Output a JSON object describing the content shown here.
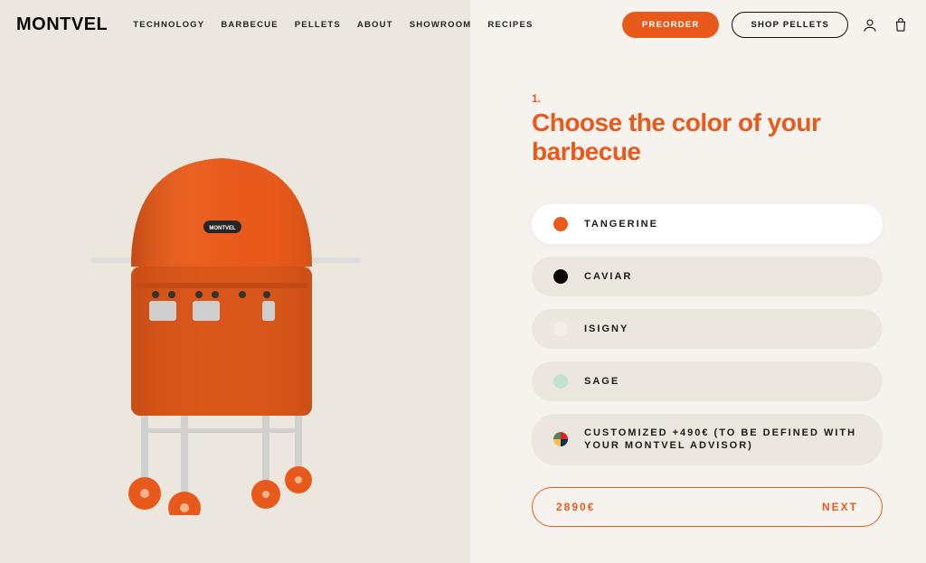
{
  "brand": "MONTVEL",
  "nav": {
    "items": [
      "TECHNOLOGY",
      "BARBECUE",
      "PELLETS",
      "ABOUT",
      "SHOWROOM",
      "RECIPES"
    ]
  },
  "header_cta": {
    "preorder": "PREORDER",
    "shop_pellets": "SHOP PELLETS"
  },
  "configurator": {
    "step_num": "1.",
    "title": "Choose the color of your barbecue",
    "options": [
      {
        "label": "TANGERINE",
        "swatch": "#e85a1b",
        "selected": true
      },
      {
        "label": "CAVIAR",
        "swatch": "#0a0a0a",
        "selected": false
      },
      {
        "label": "ISIGNY",
        "swatch": "#f2eee5",
        "selected": false
      },
      {
        "label": "SAGE",
        "swatch": "#bfe3cc",
        "selected": false
      },
      {
        "label": "CUSTOMIZED +490€ (TO BE DEFINED WITH YOUR MONTVEL ADVISOR)",
        "swatch": "multi",
        "selected": false
      }
    ],
    "price": "2890€",
    "next_label": "NEXT"
  },
  "colors": {
    "accent": "#e85a1b",
    "bg_left": "#ece7de",
    "bg_right": "#f6f3ee"
  }
}
